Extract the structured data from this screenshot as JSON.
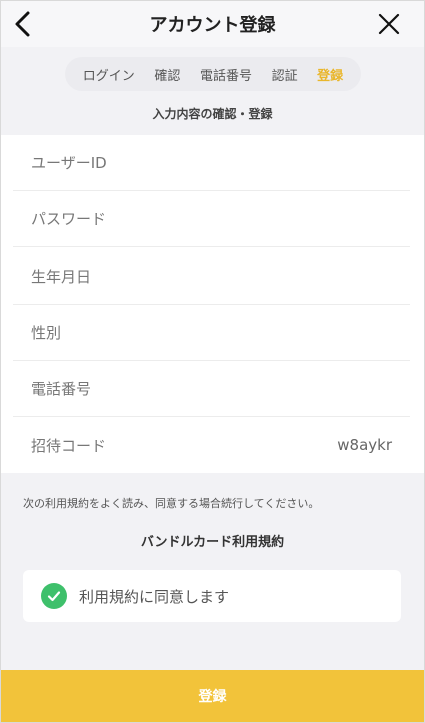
{
  "header": {
    "title": "アカウント登録",
    "back_icon": "chevron-left-icon",
    "close_icon": "close-icon"
  },
  "steps": {
    "items": [
      "ログイン",
      "確認",
      "電話番号",
      "認証",
      "登録"
    ],
    "active": "登録"
  },
  "subtitle": "入力内容の確認・登録",
  "form": {
    "fields": [
      {
        "label": "ユーザーID",
        "value": ""
      },
      {
        "label": "パスワード",
        "value": ""
      },
      {
        "label": "生年月日",
        "value": ""
      },
      {
        "label": "性別",
        "value": ""
      },
      {
        "label": "電話番号",
        "value": ""
      },
      {
        "label": "招待コード",
        "value": "w8aykr"
      }
    ]
  },
  "terms": {
    "note": "次の利用規約をよく読み、同意する場合続行してください。",
    "title": "バンドルカード利用規約",
    "agree_label": "利用規約に同意します",
    "agreed": true
  },
  "submit_label": "登録",
  "colors": {
    "accent": "#f2c33a",
    "active_step": "#e9b62c",
    "check": "#3ec06b"
  }
}
